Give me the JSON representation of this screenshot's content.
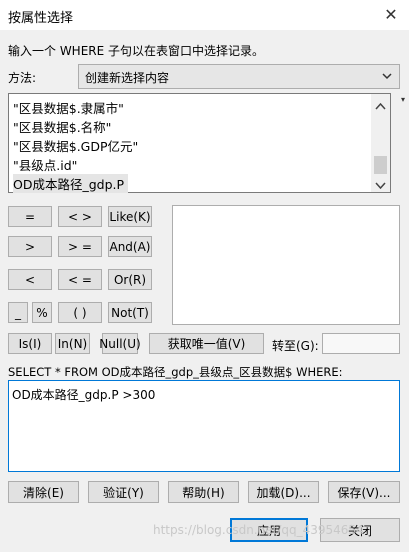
{
  "window": {
    "title": "按属性选择",
    "close_glyph": "✕"
  },
  "intro": "输入一个 WHERE 子句以在表窗口中选择记录。",
  "method": {
    "label": "方法:",
    "value": "创建新选择内容"
  },
  "fields": {
    "items": [
      "\"区县数据$.隶属市\"",
      "\"区县数据$.名称\"",
      "\"区县数据$.GDP亿元\"",
      "\"县级点.id\"",
      "OD成本路径_gdp.P"
    ]
  },
  "operators": {
    "eq": "=",
    "ne": "< >",
    "like": "Like(K)",
    "gt": ">",
    "ge": "> =",
    "and": "And(A)",
    "lt": "<",
    "le": "< =",
    "or": "Or(R)",
    "underscore": "_",
    "percent": "%",
    "parens": "( )",
    "not": "Not(T)",
    "is": "Is(I)",
    "in": "In(N)",
    "null": "Null(U)"
  },
  "unique_button": "获取唯一值(V)",
  "goto": {
    "label": "转至(G):",
    "value": ""
  },
  "sql_prefix": "SELECT * FROM OD成本路径_gdp_县级点_区县数据$ WHERE:",
  "sql_text": "OD成本路径_gdp.P >300",
  "actions": {
    "clear": "清除(E)",
    "verify": "验证(Y)",
    "help": "帮助(H)",
    "load": "加载(D)...",
    "save": "保存(V)..."
  },
  "footer": {
    "apply": "应用",
    "close": "关闭"
  },
  "watermark": "https://blog.csdn.net/qq_43954654"
}
